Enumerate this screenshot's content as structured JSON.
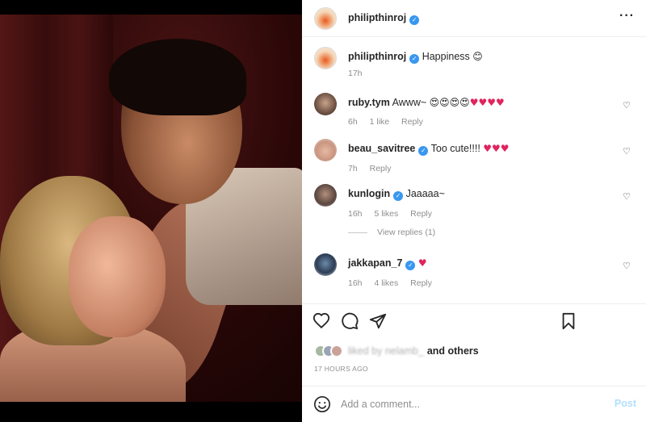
{
  "post": {
    "author": "philipthinroj",
    "caption": "Happiness",
    "caption_emoji": "😊",
    "age": "17h",
    "timestamp": "17 HOURS AGO",
    "liked_by_suffix": "and others",
    "liked_by_blurred": "liked by nelamb_"
  },
  "comments": [
    {
      "user": "ruby.tym",
      "verified": false,
      "text": "Awww~",
      "emojis": "😍😍😍😍",
      "hearts": "♥♥♥♥",
      "age": "6h",
      "likes": "1 like",
      "reply": "Reply"
    },
    {
      "user": "beau_savitree",
      "verified": true,
      "text": "Too cute!!!!",
      "emojis": "",
      "hearts": "♥♥♥",
      "age": "7h",
      "likes": "",
      "reply": "Reply"
    },
    {
      "user": "kunlogin",
      "verified": true,
      "text": "Jaaaaa~",
      "emojis": "",
      "hearts": "",
      "age": "16h",
      "likes": "5 likes",
      "reply": "Reply"
    },
    {
      "user": "jakkapan_7",
      "verified": true,
      "text": "",
      "emojis": "",
      "hearts": "♥",
      "age": "16h",
      "likes": "4 likes",
      "reply": "Reply"
    }
  ],
  "view_replies": "View replies (1)",
  "add_comment": {
    "placeholder": "Add a comment...",
    "post_label": "Post"
  },
  "icons": [
    "heart-icon",
    "comment-icon",
    "share-icon",
    "bookmark-icon",
    "emoji-icon",
    "more-icon"
  ]
}
